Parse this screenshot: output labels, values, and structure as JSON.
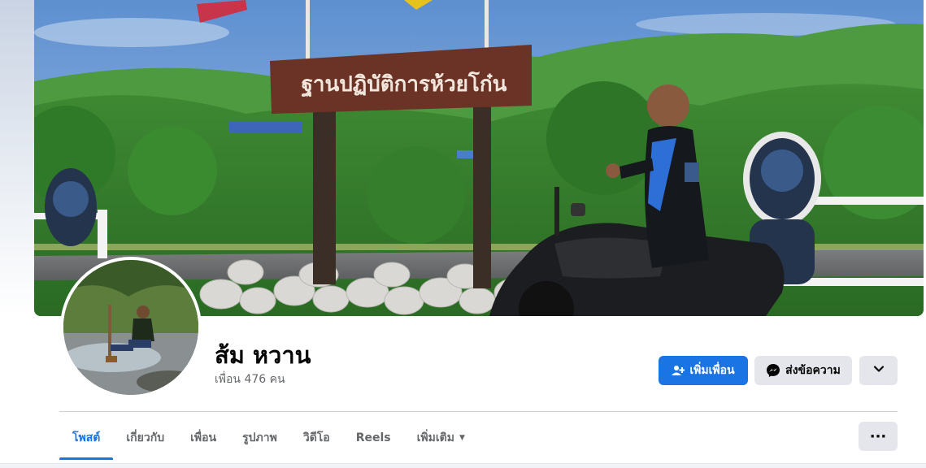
{
  "profile": {
    "name": "ส้ม หวาน",
    "friend_count": "เพื่อน 476 คน"
  },
  "cover": {
    "sign_text": "ฐานปฏิบัติการห้วยโก๋น"
  },
  "actions": {
    "add_friend_label": "เพิ่มเพื่อน",
    "message_label": "ส่งข้อความ",
    "more_icon": "chevron-down-icon"
  },
  "tabs": [
    {
      "label": "โพสต์",
      "active": true
    },
    {
      "label": "เกี่ยวกับ",
      "active": false
    },
    {
      "label": "เพื่อน",
      "active": false
    },
    {
      "label": "รูปภาพ",
      "active": false
    },
    {
      "label": "วิดีโอ",
      "active": false
    },
    {
      "label": "Reels",
      "active": false
    },
    {
      "label": "เพิ่มเติม",
      "active": false
    }
  ],
  "more_tabs_label": "···",
  "colors": {
    "accent": "#1b74e4",
    "secondary_button": "#e4e6eb",
    "text_primary": "#050505",
    "text_secondary": "#65676b"
  }
}
